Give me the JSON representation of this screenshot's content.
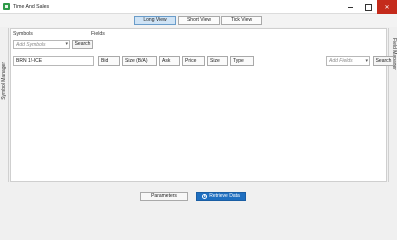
{
  "window": {
    "title": "Time And Sales"
  },
  "views": [
    {
      "label": "Long View",
      "active": true
    },
    {
      "label": "Short View",
      "active": false
    },
    {
      "label": "Tick View",
      "active": false
    }
  ],
  "side_panels": {
    "left_label": "Symbol Manager",
    "right_label": "Field Manager"
  },
  "symbols": {
    "header": "Symbols",
    "add_placeholder": "Add Symbols",
    "search_label": "Search",
    "entries": [
      "BRN 1!-ICE"
    ]
  },
  "fields": {
    "header": "Fields",
    "chips": [
      "Bid",
      "Size (B/A)",
      "Ask",
      "Price",
      "Size",
      "Type"
    ],
    "add_placeholder": "Add Fields",
    "search_label": "Search"
  },
  "footer": {
    "parameters_label": "Parameters",
    "retrieve_label": "Retrieve Data"
  },
  "colors": {
    "close_button": "#c42b1c",
    "active_view": "#cfe3f5",
    "retrieve_button": "#1f6fc0",
    "app_icon": "#2e9a48"
  },
  "icons": [
    "app-icon",
    "minimize-icon",
    "maximize-icon",
    "close-icon",
    "chevron-down-icon",
    "play-icon"
  ]
}
